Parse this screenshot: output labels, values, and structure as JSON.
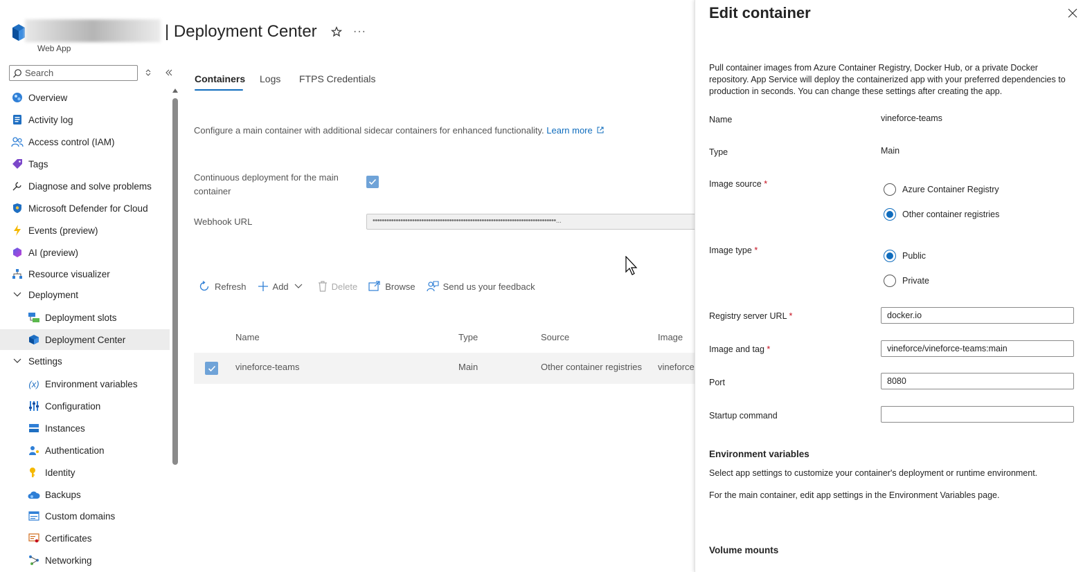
{
  "header": {
    "title": "| Deployment Center",
    "subtitle": "Web App",
    "more": "···"
  },
  "sidebar": {
    "search_placeholder": "Search",
    "items": [
      {
        "label": "Overview",
        "icon": "globe-icon"
      },
      {
        "label": "Activity log",
        "icon": "log-icon"
      },
      {
        "label": "Access control (IAM)",
        "icon": "people-icon"
      },
      {
        "label": "Tags",
        "icon": "tag-icon"
      },
      {
        "label": "Diagnose and solve problems",
        "icon": "wrench-icon"
      },
      {
        "label": "Microsoft Defender for Cloud",
        "icon": "shield-icon"
      },
      {
        "label": "Events (preview)",
        "icon": "lightning-icon"
      },
      {
        "label": "AI (preview)",
        "icon": "ai-hexagon-icon"
      },
      {
        "label": "Resource visualizer",
        "icon": "hierarchy-icon"
      },
      {
        "label": "Deployment",
        "icon": "chevron-down-icon"
      },
      {
        "label": "Deployment slots",
        "icon": "slots-icon"
      },
      {
        "label": "Deployment Center",
        "icon": "cube-icon"
      },
      {
        "label": "Settings",
        "icon": "chevron-down-icon"
      },
      {
        "label": "Environment variables",
        "icon": "variable-icon"
      },
      {
        "label": "Configuration",
        "icon": "sliders-icon"
      },
      {
        "label": "Instances",
        "icon": "instances-icon"
      },
      {
        "label": "Authentication",
        "icon": "person-key-icon"
      },
      {
        "label": "Identity",
        "icon": "key-icon"
      },
      {
        "label": "Backups",
        "icon": "cloud-icon"
      },
      {
        "label": "Custom domains",
        "icon": "domain-icon"
      },
      {
        "label": "Certificates",
        "icon": "certificate-icon"
      },
      {
        "label": "Networking",
        "icon": "network-icon"
      }
    ]
  },
  "main": {
    "tabs": [
      "Containers",
      "Logs",
      "FTPS Credentials"
    ],
    "description": "Configure a main container with additional sidecar containers for enhanced functionality.",
    "learn_more": "Learn more",
    "cd_label": "Continuous deployment for the main container",
    "webhook_label": "Webhook URL",
    "webhook_value": "•••••••••••••••••••••••••••••••••••••••••••••••••••••••••••••••••••••••••••••••...",
    "commands": {
      "refresh": "Refresh",
      "add": "Add",
      "delete": "Delete",
      "browse": "Browse",
      "feedback": "Send us your feedback"
    },
    "table": {
      "headers": [
        "Name",
        "Type",
        "Source",
        "Image"
      ],
      "rows": [
        {
          "name": "vineforce-teams",
          "type": "Main",
          "source": "Other container registries",
          "image": "vineforce"
        }
      ]
    }
  },
  "panel": {
    "title": "Edit container",
    "intro": "Pull container images from Azure Container Registry, Docker Hub, or a private Docker repository. App Service will deploy the containerized app with your preferred dependencies to production in seconds. You can change these settings after creating the app.",
    "name_label": "Name",
    "name_value": "vineforce-teams",
    "type_label": "Type",
    "type_value": "Main",
    "image_source_label": "Image source",
    "image_source_options": [
      "Azure Container Registry",
      "Other container registries"
    ],
    "image_source_selected": "Other container registries",
    "image_type_label": "Image type",
    "image_type_options": [
      "Public",
      "Private"
    ],
    "image_type_selected": "Public",
    "registry_label": "Registry server URL",
    "registry_value": "docker.io",
    "image_tag_label": "Image and tag",
    "image_tag_value": "vineforce/vineforce-teams:main",
    "port_label": "Port",
    "port_value": "8080",
    "startup_label": "Startup command",
    "startup_value": "",
    "required_mark": "*",
    "env_heading": "Environment variables",
    "env_text1": "Select app settings to customize your container's deployment or runtime environment.",
    "env_text2": "For the main container, edit app settings in the Environment Variables page.",
    "volume_heading": "Volume mounts"
  },
  "colors": {
    "accent": "#0f6cbd",
    "required": "#c50f1f",
    "checkbox_fill": "#6fa3d8",
    "selected_row": "#ececec"
  }
}
